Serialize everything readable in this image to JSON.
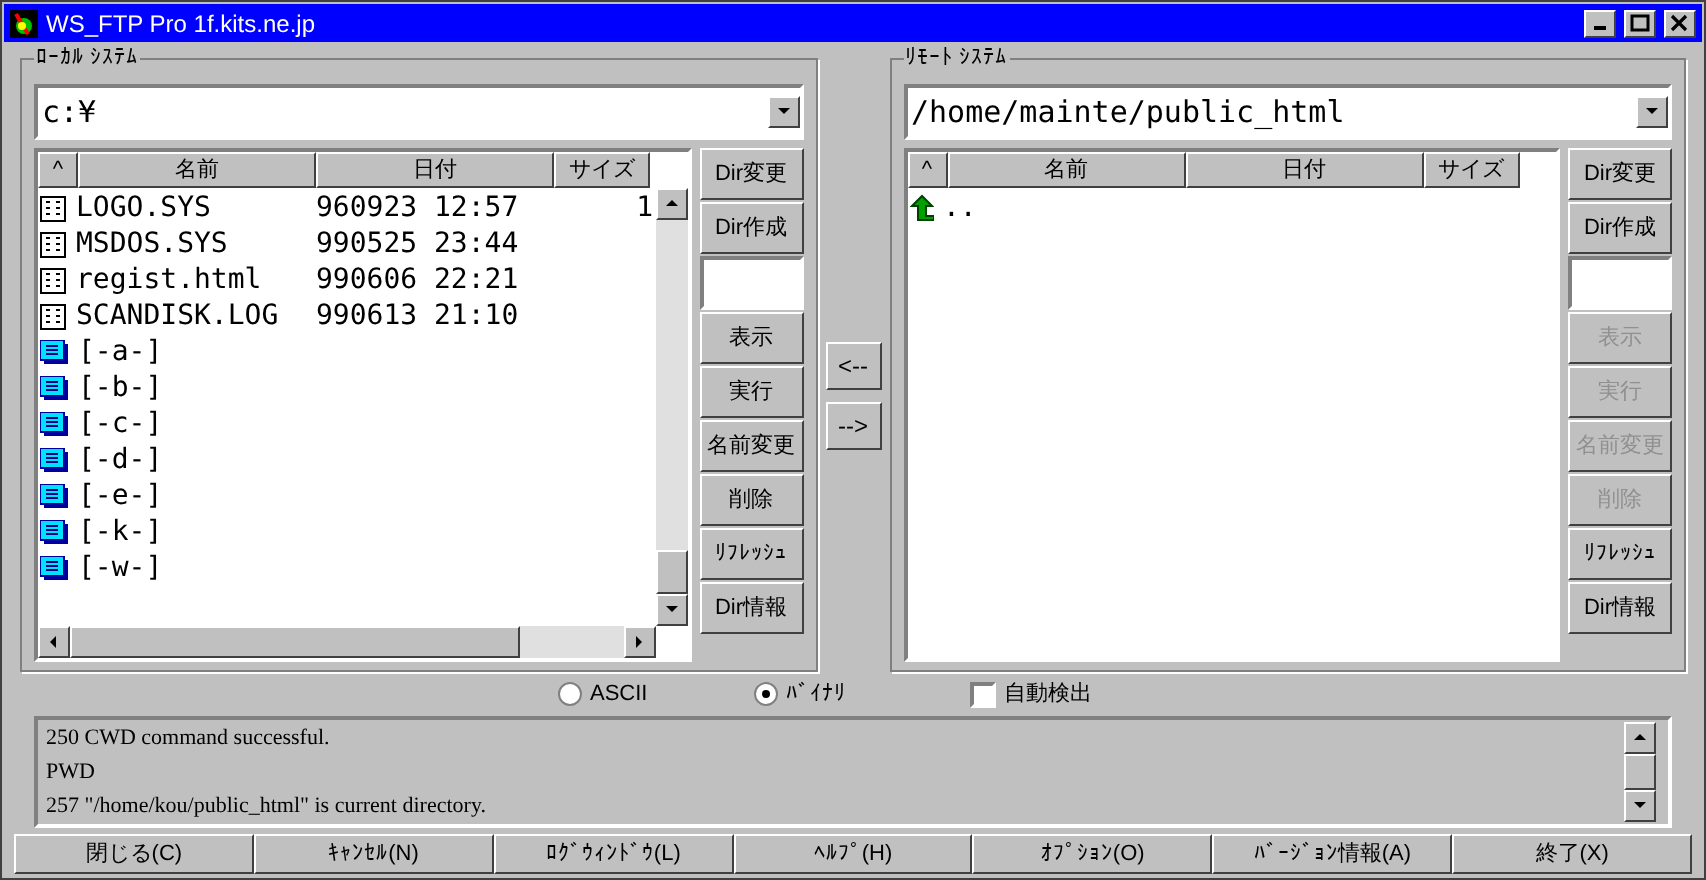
{
  "window": {
    "title": "WS_FTP Pro 1f.kits.ne.jp"
  },
  "local": {
    "label": "ﾛｰｶﾙ ｼｽﾃﾑ",
    "path": "c:¥",
    "columns": [
      "^",
      "名前",
      "日付",
      "サイズ"
    ],
    "rows": [
      {
        "kind": "file",
        "name": "LOGO.SYS",
        "date": "960923 12:57",
        "size": "1"
      },
      {
        "kind": "file",
        "name": "MSDOS.SYS",
        "date": "990525 23:44"
      },
      {
        "kind": "file",
        "name": "regist.html",
        "date": "990606 22:21"
      },
      {
        "kind": "file",
        "name": "SCANDISK.LOG",
        "date": "990613 21:10"
      },
      {
        "kind": "folder",
        "name": "[-a-]"
      },
      {
        "kind": "folder",
        "name": "[-b-]"
      },
      {
        "kind": "folder",
        "name": "[-c-]"
      },
      {
        "kind": "folder",
        "name": "[-d-]"
      },
      {
        "kind": "folder",
        "name": "[-e-]"
      },
      {
        "kind": "folder",
        "name": "[-k-]"
      },
      {
        "kind": "folder",
        "name": "[-w-]"
      }
    ],
    "buttons": [
      {
        "kind": "button",
        "label": "Dir変更",
        "disabled": false
      },
      {
        "kind": "button",
        "label": "Dir作成",
        "disabled": false
      },
      {
        "kind": "field"
      },
      {
        "kind": "button",
        "label": "表示",
        "disabled": false
      },
      {
        "kind": "button",
        "label": "実行",
        "disabled": false
      },
      {
        "kind": "button",
        "label": "名前変更",
        "disabled": false
      },
      {
        "kind": "button",
        "label": "削除",
        "disabled": false
      },
      {
        "kind": "button",
        "label": "ﾘﾌﾚｯｼｭ",
        "disabled": false
      },
      {
        "kind": "button",
        "label": "Dir情報",
        "disabled": false
      }
    ]
  },
  "transfer": [
    "<--",
    "-->"
  ],
  "remote": {
    "label": "ﾘﾓｰﾄ ｼｽﾃﾑ",
    "path": "/home/mainte/public_html",
    "columns": [
      "^",
      "名前",
      "日付",
      "サイズ"
    ],
    "rows": [
      {
        "kind": "up",
        "name": ".."
      }
    ],
    "buttons": [
      {
        "kind": "button",
        "label": "Dir変更",
        "disabled": false
      },
      {
        "kind": "button",
        "label": "Dir作成",
        "disabled": false
      },
      {
        "kind": "field"
      },
      {
        "kind": "button",
        "label": "表示",
        "disabled": true
      },
      {
        "kind": "button",
        "label": "実行",
        "disabled": true
      },
      {
        "kind": "button",
        "label": "名前変更",
        "disabled": true
      },
      {
        "kind": "button",
        "label": "削除",
        "disabled": true
      },
      {
        "kind": "button",
        "label": "ﾘﾌﾚｯｼｭ",
        "disabled": false
      },
      {
        "kind": "button",
        "label": "Dir情報",
        "disabled": false
      }
    ]
  },
  "mode": [
    {
      "label": "ASCII",
      "selected": false
    },
    {
      "label": "ﾊﾞｲﾅﾘ",
      "selected": true
    }
  ],
  "auto_detect": {
    "label": "自動検出",
    "checked": false
  },
  "log": [
    "250 CWD command successful.",
    "PWD",
    "257 \"/home/kou/public_html\" is current directory."
  ],
  "bottom_buttons": [
    "閉じる(C)",
    "ｷｬﾝｾﾙ(N)",
    "ﾛｸﾞｳｨﾝﾄﾞｳ(L)",
    "ﾍﾙﾌﾟ(H)",
    "ｵﾌﾟｼｮﾝ(O)",
    "ﾊﾞｰｼﾞｮﾝ情報(A)",
    "終了(X)"
  ]
}
